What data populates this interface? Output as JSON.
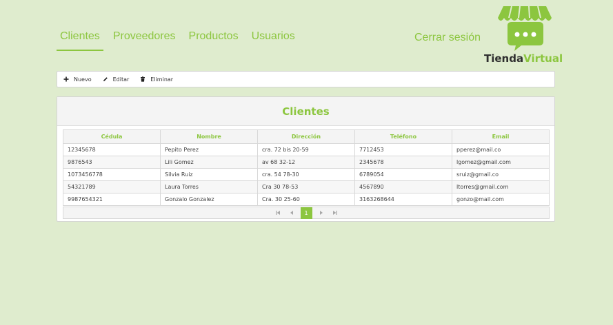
{
  "nav": {
    "items": [
      {
        "label": "Clientes",
        "active": true
      },
      {
        "label": "Proveedores",
        "active": false
      },
      {
        "label": "Productos",
        "active": false
      },
      {
        "label": "Usuarios",
        "active": false
      }
    ],
    "logout": "Cerrar sesión"
  },
  "logo": {
    "word1": "Tienda",
    "word2": "Virtual",
    "icon": "store-awning-chat-icon"
  },
  "toolbar": {
    "new_label": "Nuevo",
    "edit_label": "Editar",
    "delete_label": "Eliminar"
  },
  "panel": {
    "title": "Clientes"
  },
  "table": {
    "headers": [
      "Cédula",
      "Nombre",
      "Dirección",
      "Teléfono",
      "Email"
    ],
    "rows": [
      [
        "12345678",
        "Pepito Perez",
        "cra. 72 bis 20-59",
        "7712453",
        "pperez@mail.co"
      ],
      [
        "9876543",
        "Lili Gomez",
        "av 68 32-12",
        "2345678",
        "lgomez@gmail.com"
      ],
      [
        "1073456778",
        "Silvia Ruiz",
        "cra. 54 78-30",
        "6789054",
        "sruiz@gmail.co"
      ],
      [
        "54321789",
        "Laura Torres",
        "Cra 30 78-53",
        "4567890",
        "ltorres@gmail.com"
      ],
      [
        "9987654321",
        "Gonzalo Gonzalez",
        "Cra. 30 25-60",
        "3163268644",
        "gonzo@mail.com"
      ]
    ]
  },
  "pager": {
    "current": "1"
  },
  "colors": {
    "accent": "#8cc63f",
    "background": "#dfecce"
  }
}
